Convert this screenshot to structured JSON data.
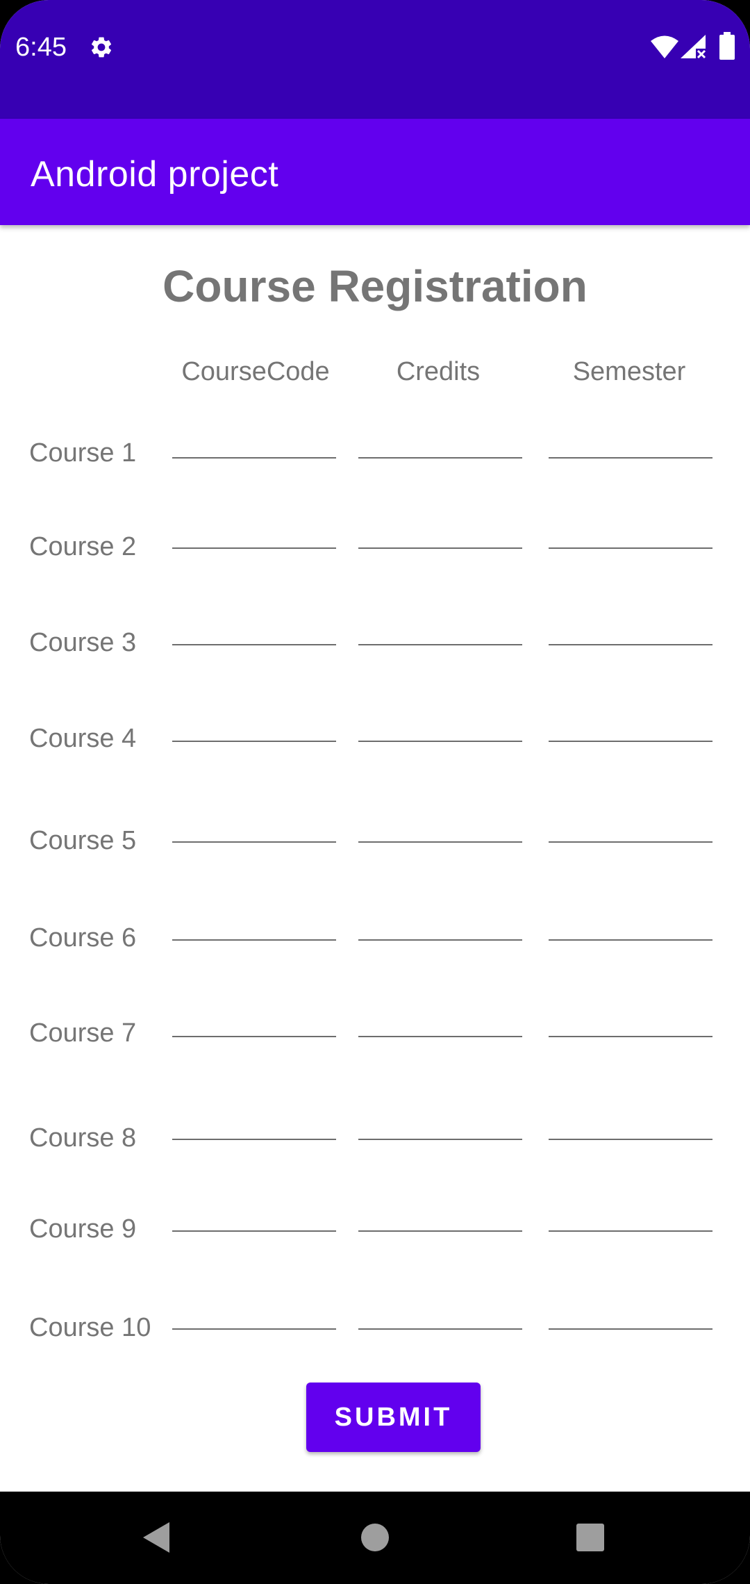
{
  "status_bar": {
    "time": "6:45",
    "icons": [
      "gear-icon",
      "wifi-icon",
      "signal-icon",
      "battery-icon"
    ],
    "background": "#3700b3"
  },
  "app_bar": {
    "title": "Android project",
    "background": "#6200ee"
  },
  "form": {
    "title": "Course Registration",
    "columns": [
      "CourseCode",
      "Credits",
      "Semester"
    ],
    "rows": [
      {
        "label": "Course 1",
        "course_code": "",
        "credits": "",
        "semester": ""
      },
      {
        "label": "Course 2",
        "course_code": "",
        "credits": "",
        "semester": ""
      },
      {
        "label": "Course 3",
        "course_code": "",
        "credits": "",
        "semester": ""
      },
      {
        "label": "Course 4",
        "course_code": "",
        "credits": "",
        "semester": ""
      },
      {
        "label": "Course 5",
        "course_code": "",
        "credits": "",
        "semester": ""
      },
      {
        "label": "Course 6",
        "course_code": "",
        "credits": "",
        "semester": ""
      },
      {
        "label": "Course 7",
        "course_code": "",
        "credits": "",
        "semester": ""
      },
      {
        "label": "Course 8",
        "course_code": "",
        "credits": "",
        "semester": ""
      },
      {
        "label": "Course 9",
        "course_code": "",
        "credits": "",
        "semester": ""
      },
      {
        "label": "Course 10",
        "course_code": "",
        "credits": "",
        "semester": ""
      }
    ],
    "submit_label": "SUBMIT"
  },
  "nav_bar": {
    "buttons": [
      "back-icon",
      "home-icon",
      "recents-icon"
    ]
  },
  "colors": {
    "accent": "#6200ee",
    "status": "#3700b3",
    "text_secondary": "#757575"
  }
}
